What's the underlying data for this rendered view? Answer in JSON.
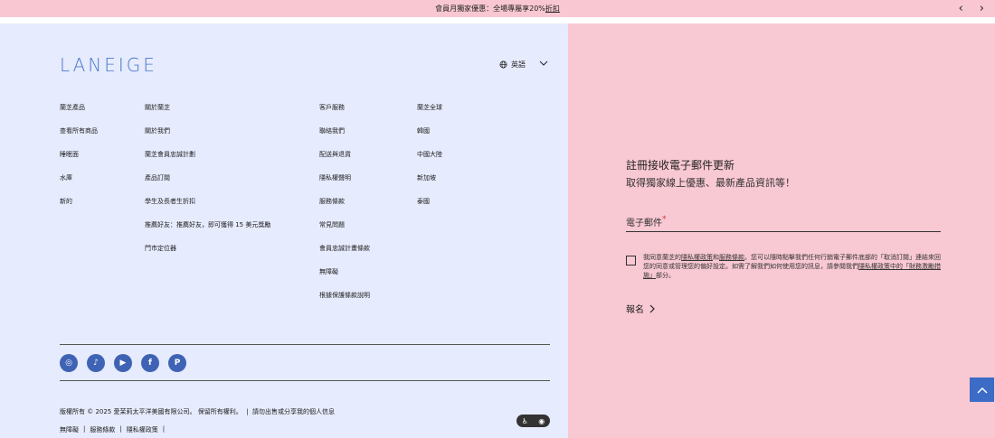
{
  "promo": {
    "text": "會員月獨家優惠：全場專屬享20%",
    "link": "折扣",
    "prev_icon": "chevron-left-icon",
    "next_icon": "chevron-right-icon"
  },
  "brand": {
    "logo": "LANEIGE",
    "color": "#4a79c9"
  },
  "language": {
    "label": "英語",
    "icon": "globe-icon",
    "chevron": "chevron-down-icon"
  },
  "columns": [
    {
      "items": [
        "蘭芝產品",
        "查看所有商品",
        "睡眠面",
        "水庫",
        "新的"
      ]
    },
    {
      "items": [
        "關於蘭芝",
        "關於我們",
        "蘭芝會員忠誠計劃",
        "產品訂閱",
        "學生及長者生折扣",
        "推薦好友：推薦好友，即可獲得 15 美元獎勵",
        "門市定位器"
      ]
    },
    {
      "items": [
        "客戶服務",
        "聯絡我們",
        "配送與退貨",
        "隱私權聲明",
        "服務條款",
        "常見問題",
        "會員忠誠計畫條款",
        "無障礙",
        "根據保護條款說明"
      ]
    },
    {
      "items": [
        "蘭芝全球",
        "韓國",
        "中國大陸",
        "新加坡",
        "泰國"
      ]
    }
  ],
  "social": [
    {
      "icon": "instagram-icon",
      "glyph": "◎"
    },
    {
      "icon": "tiktok-icon",
      "glyph": "♪"
    },
    {
      "icon": "youtube-icon",
      "glyph": "▶"
    },
    {
      "icon": "facebook-icon",
      "glyph": "f"
    },
    {
      "icon": "pinterest-icon",
      "glyph": "P"
    }
  ],
  "footer": {
    "copyright": "版權所有 © 2025 愛茉莉太平洋美國有限公司。 保留所有權利。",
    "privacy_choice": "請勿出售或分享我的個人信息",
    "links": [
      "無障礙",
      "服務條款",
      "隱私權政策"
    ]
  },
  "newsletter": {
    "title": "註冊接收電子郵件更新",
    "subtitle": "取得獨家線上優惠、最新產品資訊等！",
    "email_label": "電子郵件",
    "required_mark": "*",
    "consent_text_1": "我同意蘭芝的",
    "consent_link_1": "隱私權政策",
    "consent_and": "和",
    "consent_link_2": "服務條款",
    "consent_text_2": "。您可以隨時點擊我們任何行銷電子郵件底部的「取消訂閱」連結來回您的同意或管理您的偏好設定。如需了解我們如何使用您的訊息，請參閱我們",
    "consent_link_3": "隱私權政策中的「財務激勵措施」",
    "consent_text_3": "部分。",
    "submit_label": "報名",
    "submit_icon": "chevron-right-icon"
  },
  "scroll_top": {
    "icon": "chevron-up-icon",
    "color": "#3d6cc7"
  },
  "accessibility_badge": {
    "icon": "accessibility-icon"
  }
}
